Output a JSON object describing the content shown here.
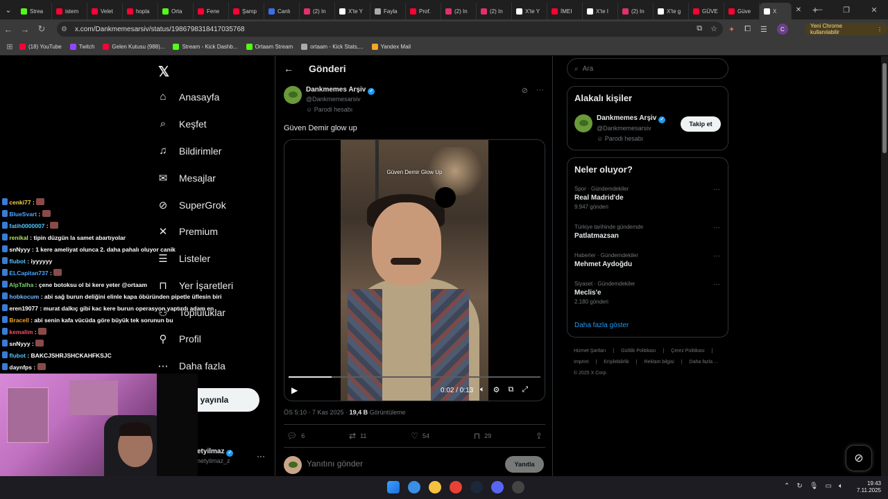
{
  "browser": {
    "tabs": [
      {
        "label": "Strea",
        "color": "#53fc18"
      },
      {
        "label": "istem",
        "color": "#ff0033"
      },
      {
        "label": "Velet",
        "color": "#ff0033"
      },
      {
        "label": "hopla",
        "color": "#ff0033"
      },
      {
        "label": "Orta",
        "color": "#53fc18"
      },
      {
        "label": "Fene",
        "color": "#ff0033"
      },
      {
        "label": "Şamp",
        "color": "#ff0033"
      },
      {
        "label": "Canlı",
        "color": "#3b6ee8"
      },
      {
        "label": "(2) In",
        "color": "#e1306c"
      },
      {
        "label": "X'te Y",
        "color": "#ffffff"
      },
      {
        "label": "Fayla",
        "color": "#aaaaaa"
      },
      {
        "label": "Prof.",
        "color": "#ff0033"
      },
      {
        "label": "(2) In",
        "color": "#e1306c"
      },
      {
        "label": "(2) In",
        "color": "#e1306c"
      },
      {
        "label": "X'te Y",
        "color": "#ffffff"
      },
      {
        "label": "İMEI",
        "color": "#ff0033"
      },
      {
        "label": "X'te I",
        "color": "#ffffff"
      },
      {
        "label": "(2) In",
        "color": "#e1306c"
      },
      {
        "label": "X'te g",
        "color": "#ffffff"
      },
      {
        "label": "GÜVE",
        "color": "#ff0033"
      },
      {
        "label": "Güve",
        "color": "#ff0033"
      },
      {
        "label": "X",
        "color": "#ffffff",
        "active": true
      }
    ],
    "url": "x.com/Dankmemesarsiv/status/1986798318417035768",
    "update_label": "Yeni Chrome kullanılabilir",
    "profile_initial": "C",
    "bookmarks": [
      {
        "label": "(18) YouTube",
        "color": "#ff0033"
      },
      {
        "label": "Twitch",
        "color": "#9146ff"
      },
      {
        "label": "Gelen Kutusu (988)...",
        "color": "#ff0033"
      },
      {
        "label": "Stream - Kick Dashb...",
        "color": "#53fc18"
      },
      {
        "label": "Ortaam Stream",
        "color": "#53fc18"
      },
      {
        "label": "ortaam - Kick Stats,...",
        "color": "#aaaaaa"
      },
      {
        "label": "Yandex Mail",
        "color": "#f5a623"
      }
    ]
  },
  "nav": {
    "items": [
      {
        "label": "Anasayfa",
        "icon": "home-icon",
        "glyph": "⌂"
      },
      {
        "label": "Keşfet",
        "icon": "search-icon",
        "glyph": "⌕"
      },
      {
        "label": "Bildirimler",
        "icon": "bell-icon",
        "glyph": "♫"
      },
      {
        "label": "Mesajlar",
        "icon": "mail-icon",
        "glyph": "✉"
      },
      {
        "label": "SuperGrok",
        "icon": "grok-icon",
        "glyph": "⊘"
      },
      {
        "label": "Premium",
        "icon": "x-icon",
        "glyph": "✕"
      },
      {
        "label": "Listeler",
        "icon": "list-icon",
        "glyph": "☰"
      },
      {
        "label": "Yer İşaretleri",
        "icon": "bookmark-icon",
        "glyph": "⊓"
      },
      {
        "label": "Topluluklar",
        "icon": "community-icon",
        "glyph": "⚇"
      },
      {
        "label": "Profil",
        "icon": "profile-icon",
        "glyph": "⚲"
      },
      {
        "label": "Daha fazla",
        "icon": "more-icon",
        "glyph": "⋯"
      }
    ],
    "post_button": "eri yayınla",
    "account_name": "etyilmaz",
    "account_handle": "netyilmaz_z"
  },
  "post": {
    "header_title": "Gönderi",
    "author_name": "Dankmemes Arşiv",
    "author_handle": "@Dankmemesarsiv",
    "parody_label": "Parodi hesabı",
    "text": "Güven Demir glow up",
    "video_overlay": "Güven Demir Glow Up",
    "video_time": "0:02 / 0:13",
    "video_progress": 0.17,
    "timestamp": "ÖS 5:10 · 7 Kas 2025",
    "views_count": "19,4 B",
    "views_label": "Görüntüleme",
    "replies": "6",
    "reposts": "11",
    "likes": "54",
    "bookmarks": "29",
    "reply_placeholder": "Yanıtını gönder",
    "reply_button": "Yanıtla"
  },
  "sidebar": {
    "search_placeholder": "Ara",
    "related_title": "Alakalı kişiler",
    "related_name": "Dankmemes Arşiv",
    "related_handle": "@Dankmemesarsiv",
    "related_parody": "Parodi hesabı",
    "follow_label": "Takip et",
    "trends_title": "Neler oluyor?",
    "trends": [
      {
        "category": "Spor · Gündemdekiler",
        "name": "Real Madrid'de",
        "count": "9.947 gönderi"
      },
      {
        "category": "Türkiye tarihinde gündemde",
        "name": "Patlatmazsan",
        "count": ""
      },
      {
        "category": "Haberler · Gündemdekiler",
        "name": "Mehmet Aydoğdu",
        "count": ""
      },
      {
        "category": "Siyaset · Gündemdekiler",
        "name": "Meclis'e",
        "count": "2.180 gönderi"
      }
    ],
    "show_more": "Daha fazla göster",
    "footer_line1": [
      "Hizmet Şartları",
      "|",
      "Gizlilik Politikası",
      "|",
      "Çerez Politikası",
      "|"
    ],
    "footer_line2": [
      "Imprint",
      "|",
      "Erişilebilirlik",
      "|",
      "Reklam bilgisi",
      "|",
      "Daha fazla ..."
    ],
    "copyright": "© 2025 X Corp."
  },
  "chat": [
    {
      "user": "cenki77",
      "msg": "",
      "color": "#f5d547"
    },
    {
      "user": "BlueSvart",
      "msg": "",
      "color": "#4aa8ff"
    },
    {
      "user": "fatih0000007",
      "msg": "",
      "color": "#52c8ff"
    },
    {
      "user": "renikal",
      "msg": "tipin düzgün la samet abartıyolar",
      "color": "#b6e36b"
    },
    {
      "user": "snNyyy",
      "msg": "1 kere ameliyat olunca 2. daha pahalı oluyor canik",
      "color": "#ffffff"
    },
    {
      "user": "flubot",
      "msg": "iyyyyyy",
      "color": "#52c8ff"
    },
    {
      "user": "ELCapitan737",
      "msg": "",
      "color": "#4aa8ff"
    },
    {
      "user": "AlpTalha",
      "msg": "çene botoksu ol bi kere yeter @ortaam",
      "color": "#7bd36b"
    },
    {
      "user": "hobkocum",
      "msg": "abi sağ burun deliğini elinle kapa öbüründen pipetle üflesin biri",
      "color": "#7ab8ff"
    },
    {
      "user": "eren19077",
      "msg": "murat dalkıç gibi kac kere burun operasyon yaptırdı adam en",
      "color": "#ffffff"
    },
    {
      "user": "Bracell",
      "msg": "abi senin kafa vücüda göre büyük tek sorunun bu",
      "color": "#f5a623"
    },
    {
      "user": "kemalim",
      "msg": "",
      "color": "#ff4d6a"
    },
    {
      "user": "snNyyy",
      "msg": "",
      "color": "#ffffff"
    },
    {
      "user": "flubot",
      "msg": "BAKCJSHRJSHCKAHFKSJC",
      "color": "#52c8ff"
    },
    {
      "user": "daynfps",
      "msg": "",
      "color": "#ffffff"
    }
  ],
  "taskbar": {
    "time": "19:43",
    "date": "7.11.2025",
    "apps": [
      "#3a8ee6",
      "#f3c340",
      "#e94235",
      "#1b2838",
      "#5865f2",
      "#444444"
    ]
  }
}
